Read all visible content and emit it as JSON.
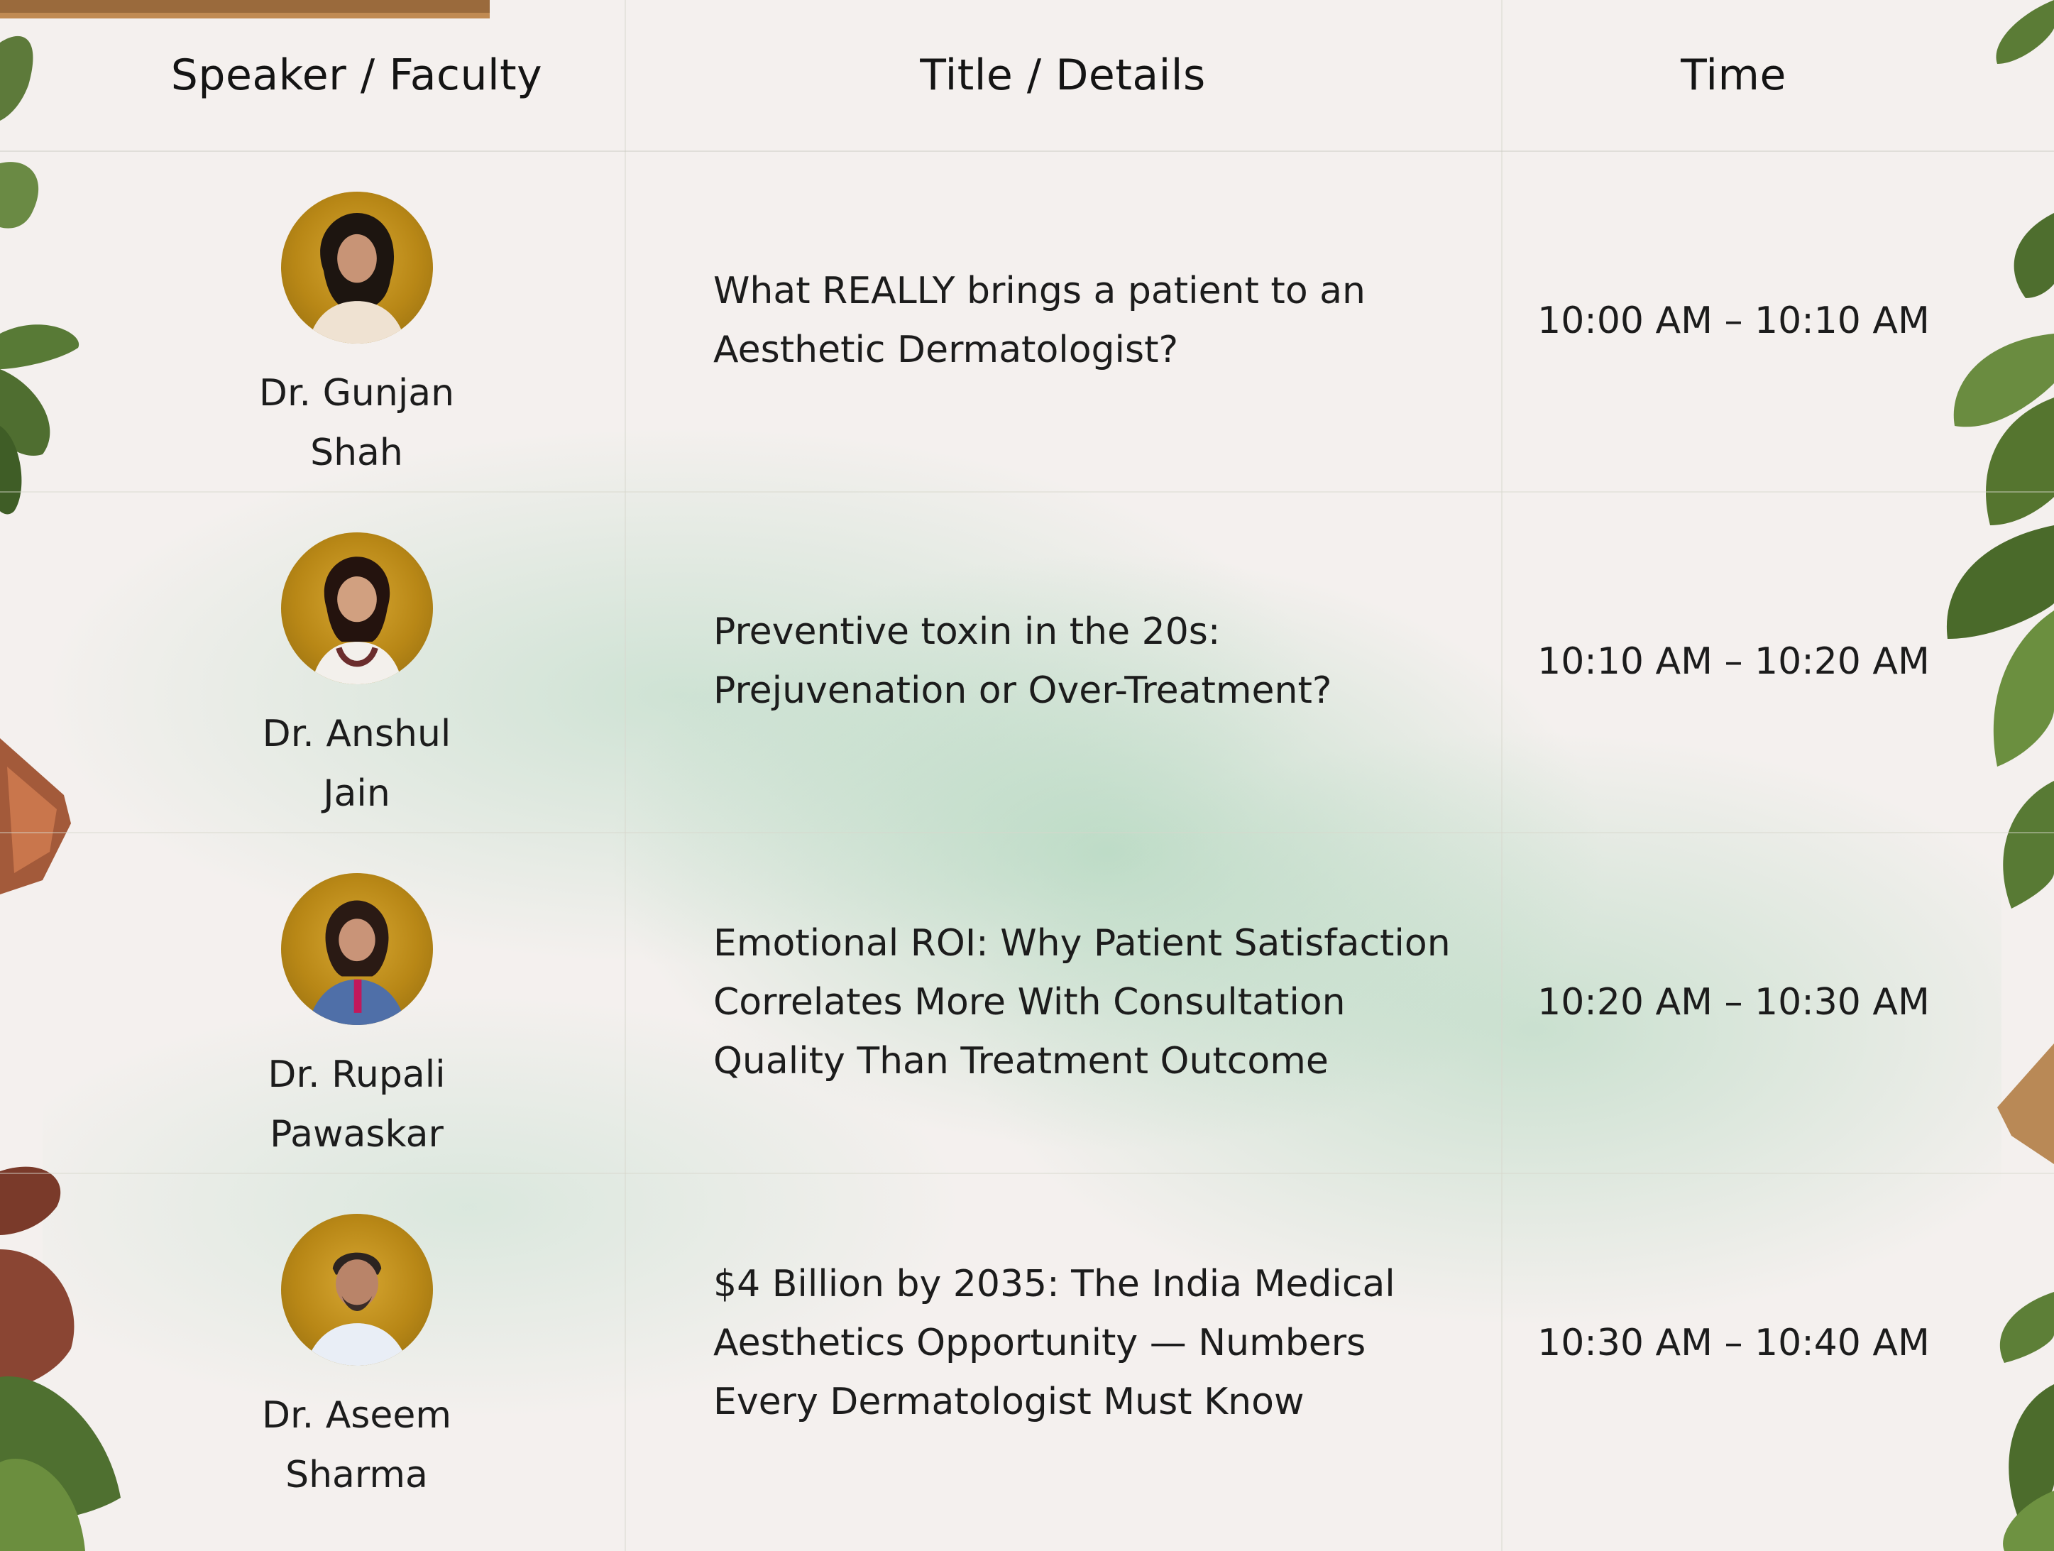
{
  "table": {
    "headers": {
      "speaker": "Speaker / Faculty",
      "title": "Title / Details",
      "time": "Time"
    },
    "rows": [
      {
        "speaker_line1": "Dr. Gunjan",
        "speaker_line2": "Shah",
        "title": "What REALLY brings a patient to an\nAesthetic Dermatologist?",
        "time": "10:00 AM – 10:10 AM"
      },
      {
        "speaker_line1": "Dr. Anshul",
        "speaker_line2": "Jain",
        "title": "Preventive toxin in the 20s:\nPrejuvenation or Over-Treatment?",
        "time": "10:10 AM – 10:20 AM"
      },
      {
        "speaker_line1": "Dr. Rupali",
        "speaker_line2": "Pawaskar",
        "title": "Emotional ROI: Why Patient Satisfaction\nCorrelates More With Consultation\nQuality Than Treatment Outcome",
        "time": "10:20 AM – 10:30 AM"
      },
      {
        "speaker_line1": "Dr. Aseem",
        "speaker_line2": "Sharma",
        "title": "$4 Billion by 2035: The India Medical\nAesthetics Opportunity — Numbers\nEvery Dermatologist Must Know",
        "time": "10:30 AM – 10:40 AM"
      }
    ]
  },
  "colors": {
    "background": "#f4f0ee",
    "wash": "#a0d2b4",
    "avatar_ring": "#b88716",
    "text": "#1c1c1c"
  }
}
